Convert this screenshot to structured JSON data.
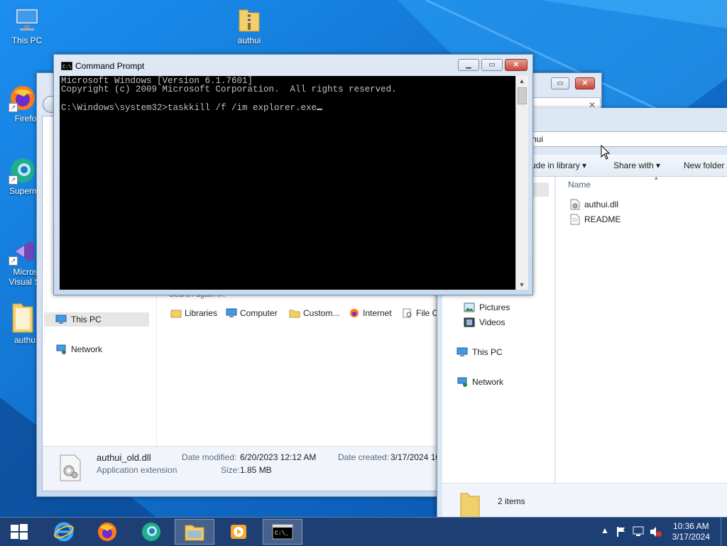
{
  "desktop": {
    "icons": [
      {
        "label": "This PC",
        "icon": "computer-icon"
      },
      {
        "label": "authui",
        "icon": "zip-folder-icon"
      },
      {
        "label": "Firefo",
        "icon": "firefox-icon"
      },
      {
        "label": "Superm",
        "icon": "supermium-icon"
      },
      {
        "label": "Micros",
        "label2": "Visual St",
        "icon": "visual-studio-icon"
      },
      {
        "label": "authu",
        "icon": "folder-icon"
      }
    ]
  },
  "cmd": {
    "title": "Command Prompt",
    "lines": [
      "Microsoft Windows [Version 6.1.7601]",
      "Copyright (c) 2009 Microsoft Corporation.  All rights reserved.",
      "",
      "C:\\Windows\\system32>taskkill /f /im explorer.exe"
    ]
  },
  "explorer_back": {
    "nav": {
      "this_pc": "This PC",
      "network": "Network"
    },
    "search_again": "Search again in:",
    "search_locations": [
      "Libraries",
      "Computer",
      "Custom...",
      "Internet",
      "File C"
    ],
    "details": {
      "name": "authui_old.dll",
      "type": "Application extension",
      "modified_label": "Date modified:",
      "modified": "6/20/2023 12:12 AM",
      "size_label": "Size:",
      "size": "1.85 MB",
      "created_label": "Date created:",
      "created": "3/17/2024 10"
    }
  },
  "explorer_front": {
    "address": "hui",
    "toolbar": {
      "include": "ude in library",
      "share": "Share with",
      "new_folder": "New folder"
    },
    "column": "Name",
    "files": [
      "authui.dll",
      "README"
    ],
    "nav": {
      "pictures": "Pictures",
      "videos": "Videos",
      "this_pc": "This PC",
      "network": "Network"
    },
    "status": "2 items"
  },
  "taskbar": {
    "time": "10:36 AM",
    "date": "3/17/2024"
  }
}
